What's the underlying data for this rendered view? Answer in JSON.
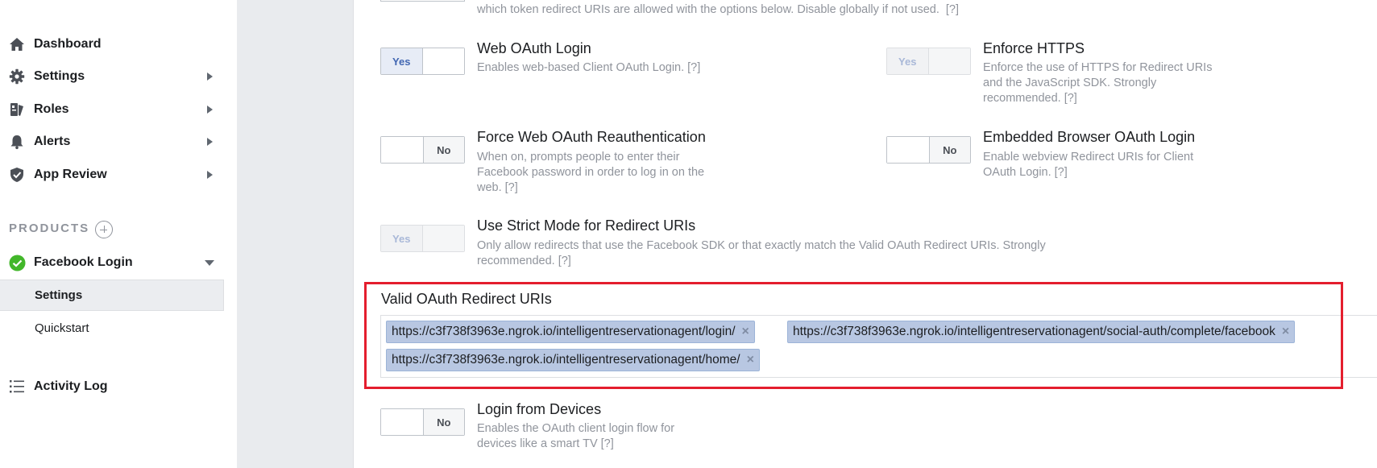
{
  "sidebar": {
    "items": [
      {
        "label": "Dashboard",
        "icon": "home-icon"
      },
      {
        "label": "Settings",
        "icon": "gear-icon"
      },
      {
        "label": "Roles",
        "icon": "roles-icon"
      },
      {
        "label": "Alerts",
        "icon": "bell-icon"
      },
      {
        "label": "App Review",
        "icon": "shield-check-icon"
      }
    ],
    "products_header": "PRODUCTS",
    "product": {
      "label": "Facebook Login",
      "icon": "check-circle-icon",
      "status_color": "#42b72a"
    },
    "sub_items": [
      "Settings",
      "Quickstart"
    ],
    "activity_log": "Activity Log"
  },
  "top_partial_desc": "which token redirect URIs are allowed with the options below. Disable globally if not used.",
  "help_mark": "[?]",
  "toggles": {
    "yes": "Yes",
    "no": "No"
  },
  "settings": {
    "web_oauth": {
      "title": "Web OAuth Login",
      "desc": "Enables web-based Client OAuth Login.",
      "state": "Yes"
    },
    "enforce_https": {
      "title": "Enforce HTTPS",
      "desc_1": "Enforce the use of HTTPS for Redirect URIs",
      "desc_2": "and the JavaScript SDK. Strongly",
      "desc_3": "recommended.",
      "state": "Yes (disabled)"
    },
    "force_reauth": {
      "title": "Force Web OAuth Reauthentication",
      "desc_1": "When on, prompts people to enter their",
      "desc_2": "Facebook password in order to log in on the",
      "desc_3": "web.",
      "state": "No"
    },
    "embedded_browser": {
      "title": "Embedded Browser OAuth Login",
      "desc_1": "Enable webview Redirect URIs for Client",
      "desc_2": "OAuth Login.",
      "state": "No"
    },
    "strict_mode": {
      "title": "Use Strict Mode for Redirect URIs",
      "desc_1": "Only allow redirects that use the Facebook SDK or that exactly match the Valid OAuth Redirect URIs. Strongly",
      "desc_2": "recommended.",
      "state": "Yes (disabled)"
    },
    "valid_uris": {
      "label": "Valid OAuth Redirect URIs",
      "uris": [
        "https://c3f738f3963e.ngrok.io/intelligentreservationagent/login/",
        "https://c3f738f3963e.ngrok.io/intelligentreservationagent/social-auth/complete/facebook",
        "https://c3f738f3963e.ngrok.io/intelligentreservationagent/home/"
      ],
      "remove_glyph": "×"
    },
    "login_devices": {
      "title": "Login from Devices",
      "desc_1": "Enables the OAuth client login flow for",
      "desc_2": "devices like a smart TV",
      "state": "No"
    }
  },
  "colors": {
    "highlight": "#e41e2e",
    "accent": "#4267b2"
  }
}
